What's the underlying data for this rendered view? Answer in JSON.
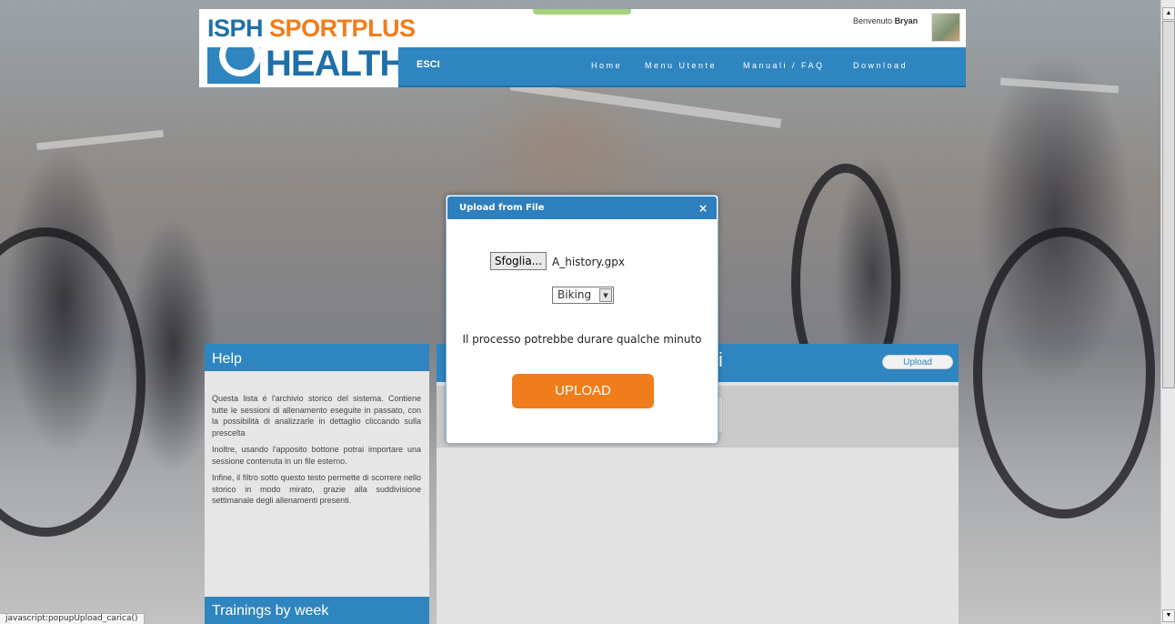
{
  "brand": {
    "logo_top_left": "ISPH",
    "logo_top_right": "SPORTPLUS",
    "logo_bottom": "HEALTH"
  },
  "header": {
    "welcome_prefix": "Benvenuto",
    "user_name": "Bryan",
    "logout_label": "ESCI",
    "nav": [
      "Home",
      "Menu Utente",
      "Manuali / FAQ",
      "Download"
    ]
  },
  "sidebar": {
    "help_title": "Help",
    "help_paragraphs": [
      "Questa lista é l'archivio storico del sistema. Contiene tutte le sessioni di allenamento eseguite in passato, con la possibilità di analizzarle in dettaglio cliccando sulla prescelta",
      "Inoltre, usando l'apposito bottone potrai importare una sessione contenuta in un file esterno.",
      "Infine, il filtro sotto questo testo permette di scorrere nello storico in modo mirato, grazie alla suddivisione settimanale degli allenamenti presenti."
    ],
    "trainings_title": "Trainings by week"
  },
  "content": {
    "title_fragment": "i",
    "upload_button": "Upload"
  },
  "modal": {
    "title": "Upload from File",
    "close_symbol": "×",
    "browse_label": "Sfoglia...",
    "file_name": "A_history.gpx",
    "sport_selected": "Biking",
    "select_arrow": "▼",
    "note": "Il processo potrebbe durare qualche minuto",
    "submit_label": "UPLOAD"
  },
  "statusbar": {
    "text": "javascript:popupUpload_carica()"
  },
  "colors": {
    "brand_blue": "#2f85c0",
    "accent_orange": "#f07d1c"
  },
  "icons": {
    "close": "close-icon",
    "scroll_up": "chevron-up-icon",
    "scroll_down": "chevron-down-icon"
  }
}
